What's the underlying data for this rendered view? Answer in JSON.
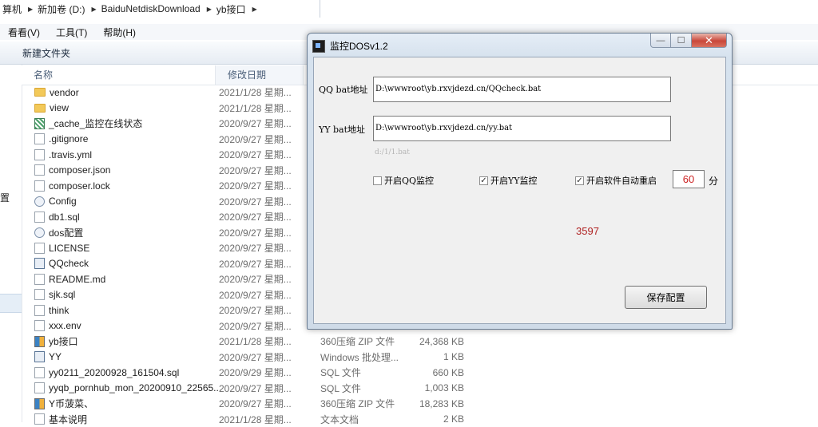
{
  "explorer": {
    "breadcrumb": [
      "算机",
      "新加卷 (D:)",
      "BaiduNetdiskDownload",
      "yb接口"
    ],
    "menu": [
      "看看(V)",
      "工具(T)",
      "帮助(H)"
    ],
    "toolbar": {
      "new_folder": "新建文件夹"
    },
    "nav_partial": "置",
    "columns": {
      "name": "名称",
      "date": "修改日期"
    },
    "files": [
      {
        "name": "vendor",
        "date": "2021/1/28 星期...",
        "type": "",
        "size": "",
        "icon": "folder-icon"
      },
      {
        "name": "view",
        "date": "2021/1/28 星期...",
        "type": "",
        "size": "",
        "icon": "folder-icon"
      },
      {
        "name": "_cache_监控在线状态",
        "date": "2020/9/27 星期...",
        "type": "",
        "size": "",
        "icon": "cache-file-icon"
      },
      {
        "name": ".gitignore",
        "date": "2020/9/27 星期...",
        "type": "",
        "size": "",
        "icon": "file-icon"
      },
      {
        "name": ".travis.yml",
        "date": "2020/9/27 星期...",
        "type": "",
        "size": "",
        "icon": "file-icon"
      },
      {
        "name": "composer.json",
        "date": "2020/9/27 星期...",
        "type": "",
        "size": "",
        "icon": "file-icon"
      },
      {
        "name": "composer.lock",
        "date": "2020/9/27 星期...",
        "type": "",
        "size": "",
        "icon": "file-icon"
      },
      {
        "name": "Config",
        "date": "2020/9/27 星期...",
        "type": "",
        "size": "",
        "icon": "settings-file-icon"
      },
      {
        "name": "db1.sql",
        "date": "2020/9/27 星期...",
        "type": "",
        "size": "",
        "icon": "file-icon"
      },
      {
        "name": "dos配置",
        "date": "2020/9/27 星期...",
        "type": "",
        "size": "",
        "icon": "settings-file-icon"
      },
      {
        "name": "LICENSE",
        "date": "2020/9/27 星期...",
        "type": "",
        "size": "",
        "icon": "file-icon"
      },
      {
        "name": "QQcheck",
        "date": "2020/9/27 星期...",
        "type": "",
        "size": "",
        "icon": "app-icon"
      },
      {
        "name": "README.md",
        "date": "2020/9/27 星期...",
        "type": "",
        "size": "",
        "icon": "file-icon"
      },
      {
        "name": "sjk.sql",
        "date": "2020/9/27 星期...",
        "type": "",
        "size": "",
        "icon": "file-icon"
      },
      {
        "name": "think",
        "date": "2020/9/27 星期...",
        "type": "",
        "size": "",
        "icon": "file-icon"
      },
      {
        "name": "xxx.env",
        "date": "2020/9/27 星期...",
        "type": "",
        "size": "",
        "icon": "file-icon"
      },
      {
        "name": "yb接口",
        "date": "2021/1/28 星期...",
        "type": "360压缩 ZIP 文件",
        "size": "24,368 KB",
        "icon": "zip-icon"
      },
      {
        "name": "YY",
        "date": "2020/9/27 星期...",
        "type": "Windows 批处理...",
        "size": "1 KB",
        "icon": "app-icon"
      },
      {
        "name": "yy0211_20200928_161504.sql",
        "date": "2020/9/29 星期...",
        "type": "SQL 文件",
        "size": "660 KB",
        "icon": "file-icon"
      },
      {
        "name": "yyqb_pornhub_mon_20200910_22565...",
        "date": "2020/9/27 星期...",
        "type": "SQL 文件",
        "size": "1,003 KB",
        "icon": "file-icon"
      },
      {
        "name": "Y币菠菜、",
        "date": "2020/9/27 星期...",
        "type": "360压缩 ZIP 文件",
        "size": "18,283 KB",
        "icon": "zip-icon"
      },
      {
        "name": "基本说明",
        "date": "2021/1/28 星期...",
        "type": "文本文档",
        "size": "2 KB",
        "icon": "file-icon"
      }
    ]
  },
  "dialog": {
    "title": "监控DOSv1.2",
    "qq_label": "QQ bat地址",
    "qq_value": "D:\\wwwroot\\yb.rxvjdezd.cn/QQcheck.bat",
    "yy_label": "YY bat地址",
    "yy_value": "D:\\wwwroot\\yb.rxvjdezd.cn/yy.bat",
    "hint": "d:/1/1.bat",
    "chk_qq": {
      "label": "开启QQ监控",
      "checked": false
    },
    "chk_yy": {
      "label": "开启YY监控",
      "checked": true
    },
    "chk_restart": {
      "label": "开启软件自动重启",
      "checked": true
    },
    "restart_minutes": "60",
    "unit": "分",
    "counter": "3597",
    "save_label": "保存配置",
    "close_glyph": "✕",
    "max_glyph": "☐",
    "min_glyph": "—"
  }
}
